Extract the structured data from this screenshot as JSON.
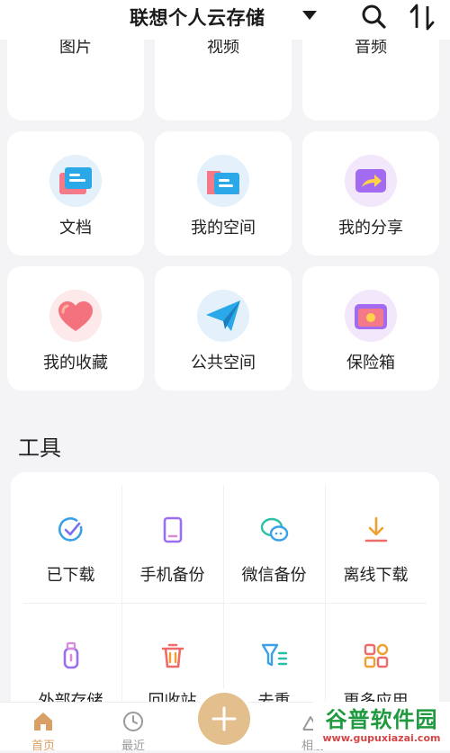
{
  "header": {
    "title": "联想个人云存储"
  },
  "categories": [
    {
      "label": "图片"
    },
    {
      "label": "视频"
    },
    {
      "label": "音频"
    },
    {
      "label": "文档"
    },
    {
      "label": "我的空间"
    },
    {
      "label": "我的分享"
    },
    {
      "label": "我的收藏"
    },
    {
      "label": "公共空间"
    },
    {
      "label": "保险箱"
    }
  ],
  "tools_section": {
    "title": "工具",
    "items": [
      {
        "label": "已下载"
      },
      {
        "label": "手机备份"
      },
      {
        "label": "微信备份"
      },
      {
        "label": "离线下载"
      },
      {
        "label": "外部存储"
      },
      {
        "label": "回收站"
      },
      {
        "label": "去重"
      },
      {
        "label": "更多应用"
      }
    ]
  },
  "tabbar": {
    "home": "首页",
    "recent": "最近",
    "album": "相册",
    "active_color": "#d9a066",
    "inactive_color": "#9a9a9a"
  },
  "watermark": {
    "main": "谷普软件园",
    "sub": "www.gupuxiazai.com"
  }
}
